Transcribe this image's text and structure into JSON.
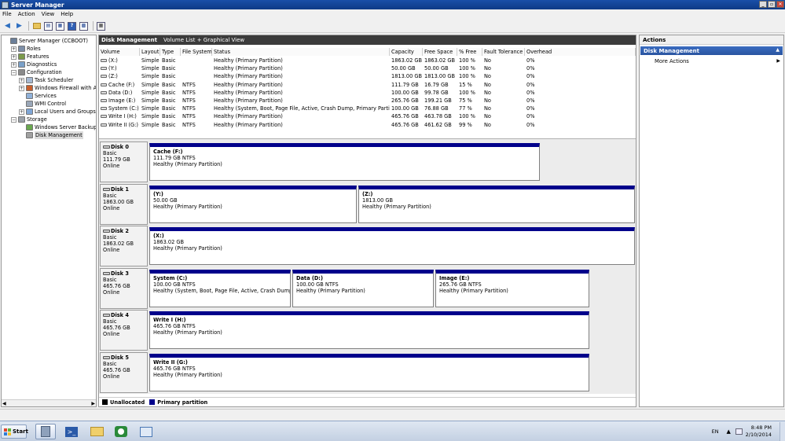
{
  "window": {
    "title": "Server Manager",
    "controls": [
      "_",
      "▫",
      "✕"
    ]
  },
  "menu": [
    "File",
    "Action",
    "View",
    "Help"
  ],
  "tree": [
    {
      "label": "Server Manager (CCBOOT)",
      "indent": 0,
      "exp": "",
      "icon": "server-icon",
      "color": "#6b7f99"
    },
    {
      "label": "Roles",
      "indent": 1,
      "exp": "+",
      "icon": "roles-icon",
      "color": "#7d8fa8"
    },
    {
      "label": "Features",
      "indent": 1,
      "exp": "+",
      "icon": "features-icon",
      "color": "#7b9a4a"
    },
    {
      "label": "Diagnostics",
      "indent": 1,
      "exp": "+",
      "icon": "diagnostics-icon",
      "color": "#7aa0c8"
    },
    {
      "label": "Configuration",
      "indent": 1,
      "exp": "−",
      "icon": "configuration-icon",
      "color": "#8a8a8a"
    },
    {
      "label": "Task Scheduler",
      "indent": 2,
      "exp": "+",
      "icon": "clock-icon",
      "color": "#a6b9d2"
    },
    {
      "label": "Windows Firewall with Adva",
      "indent": 2,
      "exp": "+",
      "icon": "firewall-icon",
      "color": "#c75f2e"
    },
    {
      "label": "Services",
      "indent": 2,
      "exp": "",
      "icon": "services-icon",
      "color": "#8fb0d8"
    },
    {
      "label": "WMI Control",
      "indent": 2,
      "exp": "",
      "icon": "wmi-icon",
      "color": "#9aa7b8"
    },
    {
      "label": "Local Users and Groups",
      "indent": 2,
      "exp": "+",
      "icon": "users-icon",
      "color": "#7fa6d6"
    },
    {
      "label": "Storage",
      "indent": 1,
      "exp": "−",
      "icon": "storage-icon",
      "color": "#9aa0a8"
    },
    {
      "label": "Windows Server Backup",
      "indent": 2,
      "exp": "",
      "icon": "backup-icon",
      "color": "#6aa84f"
    },
    {
      "label": "Disk Management",
      "indent": 2,
      "exp": "",
      "icon": "disk-icon",
      "color": "#a0a0a0",
      "selected": true
    }
  ],
  "center": {
    "title": "Disk Management",
    "subtitle": "Volume List + Graphical View"
  },
  "volume_table": {
    "columns": [
      "Volume",
      "Layout",
      "Type",
      "File System",
      "Status",
      "Capacity",
      "Free Space",
      "% Free",
      "Fault Tolerance",
      "Overhead"
    ],
    "rows": [
      [
        "(X:)",
        "Simple",
        "Basic",
        "",
        "Healthy (Primary Partition)",
        "1863.02 GB",
        "1863.02 GB",
        "100 %",
        "No",
        "0%"
      ],
      [
        "(Y:)",
        "Simple",
        "Basic",
        "",
        "Healthy (Primary Partition)",
        "50.00 GB",
        "50.00 GB",
        "100 %",
        "No",
        "0%"
      ],
      [
        "(Z:)",
        "Simple",
        "Basic",
        "",
        "Healthy (Primary Partition)",
        "1813.00 GB",
        "1813.00 GB",
        "100 %",
        "No",
        "0%"
      ],
      [
        "Cache (F:)",
        "Simple",
        "Basic",
        "NTFS",
        "Healthy (Primary Partition)",
        "111.79 GB",
        "16.79 GB",
        "15 %",
        "No",
        "0%"
      ],
      [
        "Data (D:)",
        "Simple",
        "Basic",
        "NTFS",
        "Healthy (Primary Partition)",
        "100.00 GB",
        "99.78 GB",
        "100 %",
        "No",
        "0%"
      ],
      [
        "Image (E:)",
        "Simple",
        "Basic",
        "NTFS",
        "Healthy (Primary Partition)",
        "265.76 GB",
        "199.21 GB",
        "75 %",
        "No",
        "0%"
      ],
      [
        "System (C:)",
        "Simple",
        "Basic",
        "NTFS",
        "Healthy (System, Boot, Page File, Active, Crash Dump, Primary Partition)",
        "100.00 GB",
        "76.88 GB",
        "77 %",
        "No",
        "0%"
      ],
      [
        "Write I (H:)",
        "Simple",
        "Basic",
        "NTFS",
        "Healthy (Primary Partition)",
        "465.76 GB",
        "463.78 GB",
        "100 %",
        "No",
        "0%"
      ],
      [
        "Write II (G:)",
        "Simple",
        "Basic",
        "NTFS",
        "Healthy (Primary Partition)",
        "465.76 GB",
        "461.62 GB",
        "99 %",
        "No",
        "0%"
      ]
    ]
  },
  "disks": [
    {
      "name": "Disk 0",
      "type": "Basic",
      "size": "111.79 GB",
      "status": "Online",
      "partitions": [
        {
          "name": "Cache  (F:)",
          "size": "111.79 GB NTFS",
          "status": "Healthy (Primary Partition)"
        }
      ]
    },
    {
      "name": "Disk 1",
      "type": "Basic",
      "size": "1863.00 GB",
      "status": "Online",
      "partitions": [
        {
          "name": "(Y:)",
          "size": "50.00 GB",
          "status": "Healthy (Primary Partition)"
        },
        {
          "name": "(Z:)",
          "size": "1813.00 GB",
          "status": "Healthy (Primary Partition)"
        }
      ]
    },
    {
      "name": "Disk 2",
      "type": "Basic",
      "size": "1863.02 GB",
      "status": "Online",
      "partitions": [
        {
          "name": "(X:)",
          "size": "1863.02 GB",
          "status": "Healthy (Primary Partition)"
        }
      ]
    },
    {
      "name": "Disk 3",
      "type": "Basic",
      "size": "465.76 GB",
      "status": "Online",
      "partitions": [
        {
          "name": "System  (C:)",
          "size": "100.00 GB NTFS",
          "status": "Healthy (System, Boot, Page File, Active, Crash Dump, Pr"
        },
        {
          "name": "Data  (D:)",
          "size": "100.00 GB NTFS",
          "status": "Healthy (Primary Partition)"
        },
        {
          "name": "Image  (E:)",
          "size": "265.76 GB NTFS",
          "status": "Healthy (Primary Partition)"
        }
      ]
    },
    {
      "name": "Disk 4",
      "type": "Basic",
      "size": "465.76 GB",
      "status": "Online",
      "partitions": [
        {
          "name": "Write I  (H:)",
          "size": "465.76 GB NTFS",
          "status": "Healthy (Primary Partition)"
        }
      ]
    },
    {
      "name": "Disk 5",
      "type": "Basic",
      "size": "465.76 GB",
      "status": "Online",
      "partitions": [
        {
          "name": "Write II  (G:)",
          "size": "465.76 GB NTFS",
          "status": "Healthy (Primary Partition)"
        }
      ]
    }
  ],
  "legend": [
    {
      "label": "Unallocated",
      "color": "#000000"
    },
    {
      "label": "Primary partition",
      "color": "#00008b"
    }
  ],
  "actions": {
    "title": "Actions",
    "section": "Disk Management",
    "more": "More Actions"
  },
  "taskbar": {
    "start": "Start",
    "language": "EN",
    "time": "8:48 PM",
    "date": "2/10/2014"
  }
}
